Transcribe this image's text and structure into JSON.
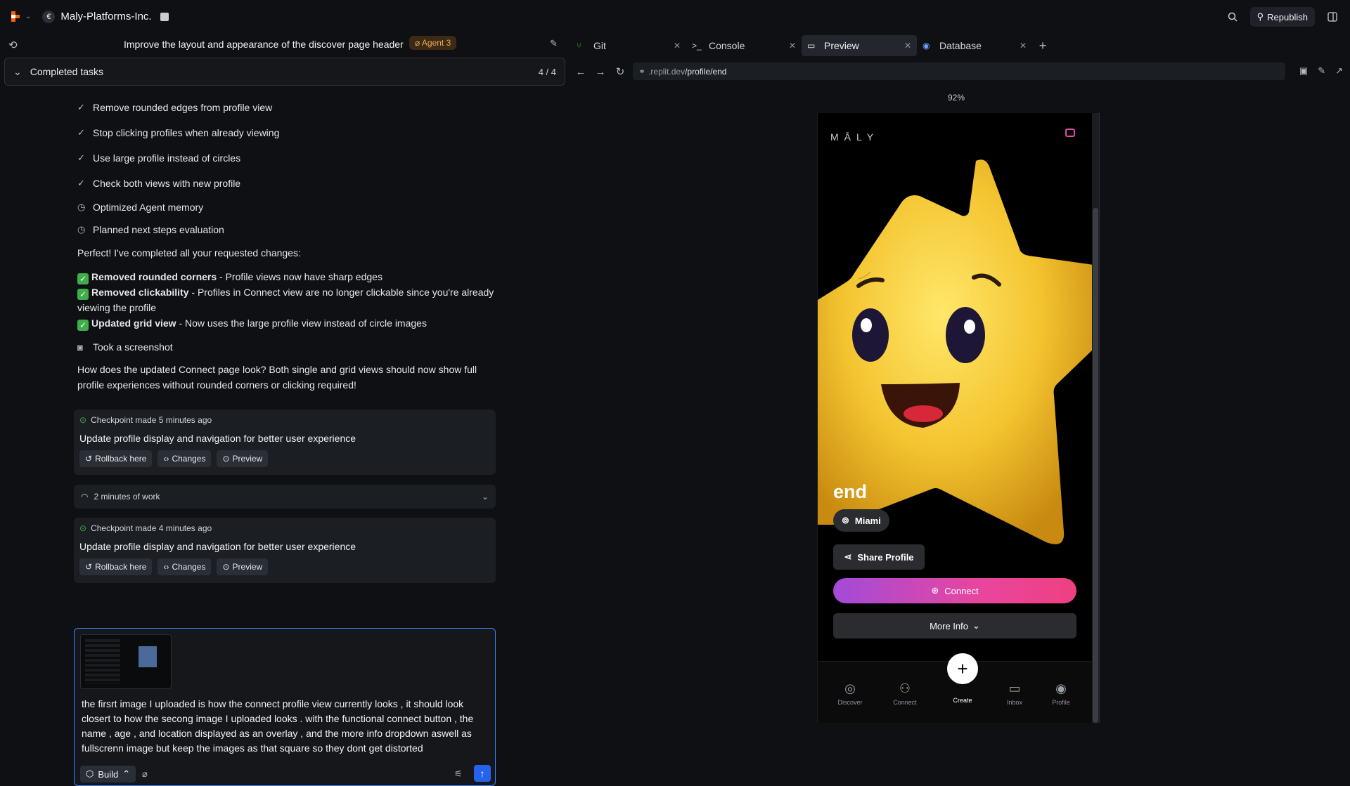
{
  "topbar": {
    "workspace_initial": "€",
    "workspace_name": "Maly-Platforms-Inc.",
    "republish_label": "Republish"
  },
  "task": {
    "title": "Improve the layout and appearance of the discover page header",
    "agent_badge": "Agent 3",
    "completed_label": "Completed tasks",
    "completed_count": "4 / 4"
  },
  "chat": {
    "tasks": [
      "Remove rounded edges from profile view",
      "Stop clicking profiles when already viewing",
      "Use large profile instead of circles",
      "Check both views with new profile"
    ],
    "events": [
      "Optimized Agent memory",
      "Planned next steps evaluation"
    ],
    "intro": "Perfect! I've completed all your requested changes:",
    "changes": [
      {
        "bold": "Removed rounded corners",
        "text": " - Profile views now have sharp edges"
      },
      {
        "bold": "Removed clickability",
        "text": " - Profiles in Connect view are no longer clickable since you're already viewing the profile"
      },
      {
        "bold": "Updated grid view",
        "text": " - Now uses the large profile view instead of circle images"
      }
    ],
    "screenshot_label": "Took a screenshot",
    "question": "How does the updated Connect page look? Both single and grid views should now show full profile experiences without rounded corners or clicking required!",
    "checkpoint1": {
      "meta": "Checkpoint made 5 minutes ago",
      "title": "Update profile display and navigation for better user experience"
    },
    "work_label": "2 minutes of work",
    "checkpoint2": {
      "meta": "Checkpoint made 4 minutes ago",
      "title": "Update profile display and navigation for better user experience"
    },
    "buttons": {
      "rollback": "Rollback here",
      "changes": "Changes",
      "preview": "Preview"
    }
  },
  "composer": {
    "text": "the firsrt image I uploaded is how the connect profile view currently looks , it should look closert to how the secong image I uploaded looks . with the functional connect button , the name , age , and location displayed as an overlay , and the more info dropdown aswell as fullscrenn image but keep the images as that square so they dont get distorted",
    "mode": "Build"
  },
  "tabs": [
    {
      "label": "Git",
      "icon": "git-icon"
    },
    {
      "label": "Console",
      "icon": "console-icon"
    },
    {
      "label": "Preview",
      "icon": "monitor-icon",
      "active": true
    },
    {
      "label": "Database",
      "icon": "database-icon"
    }
  ],
  "url": {
    "prefix": ".replit.dev",
    "path": "/profile/end"
  },
  "zoom": "92%",
  "app": {
    "brand": "MĀLY",
    "profile_name": "end",
    "location": "Miami",
    "share": "Share Profile",
    "connect": "Connect",
    "more_info": "More Info",
    "nav": [
      "Discover",
      "Connect",
      "Create",
      "Inbox",
      "Profile"
    ],
    "accent": "#e8469e"
  }
}
